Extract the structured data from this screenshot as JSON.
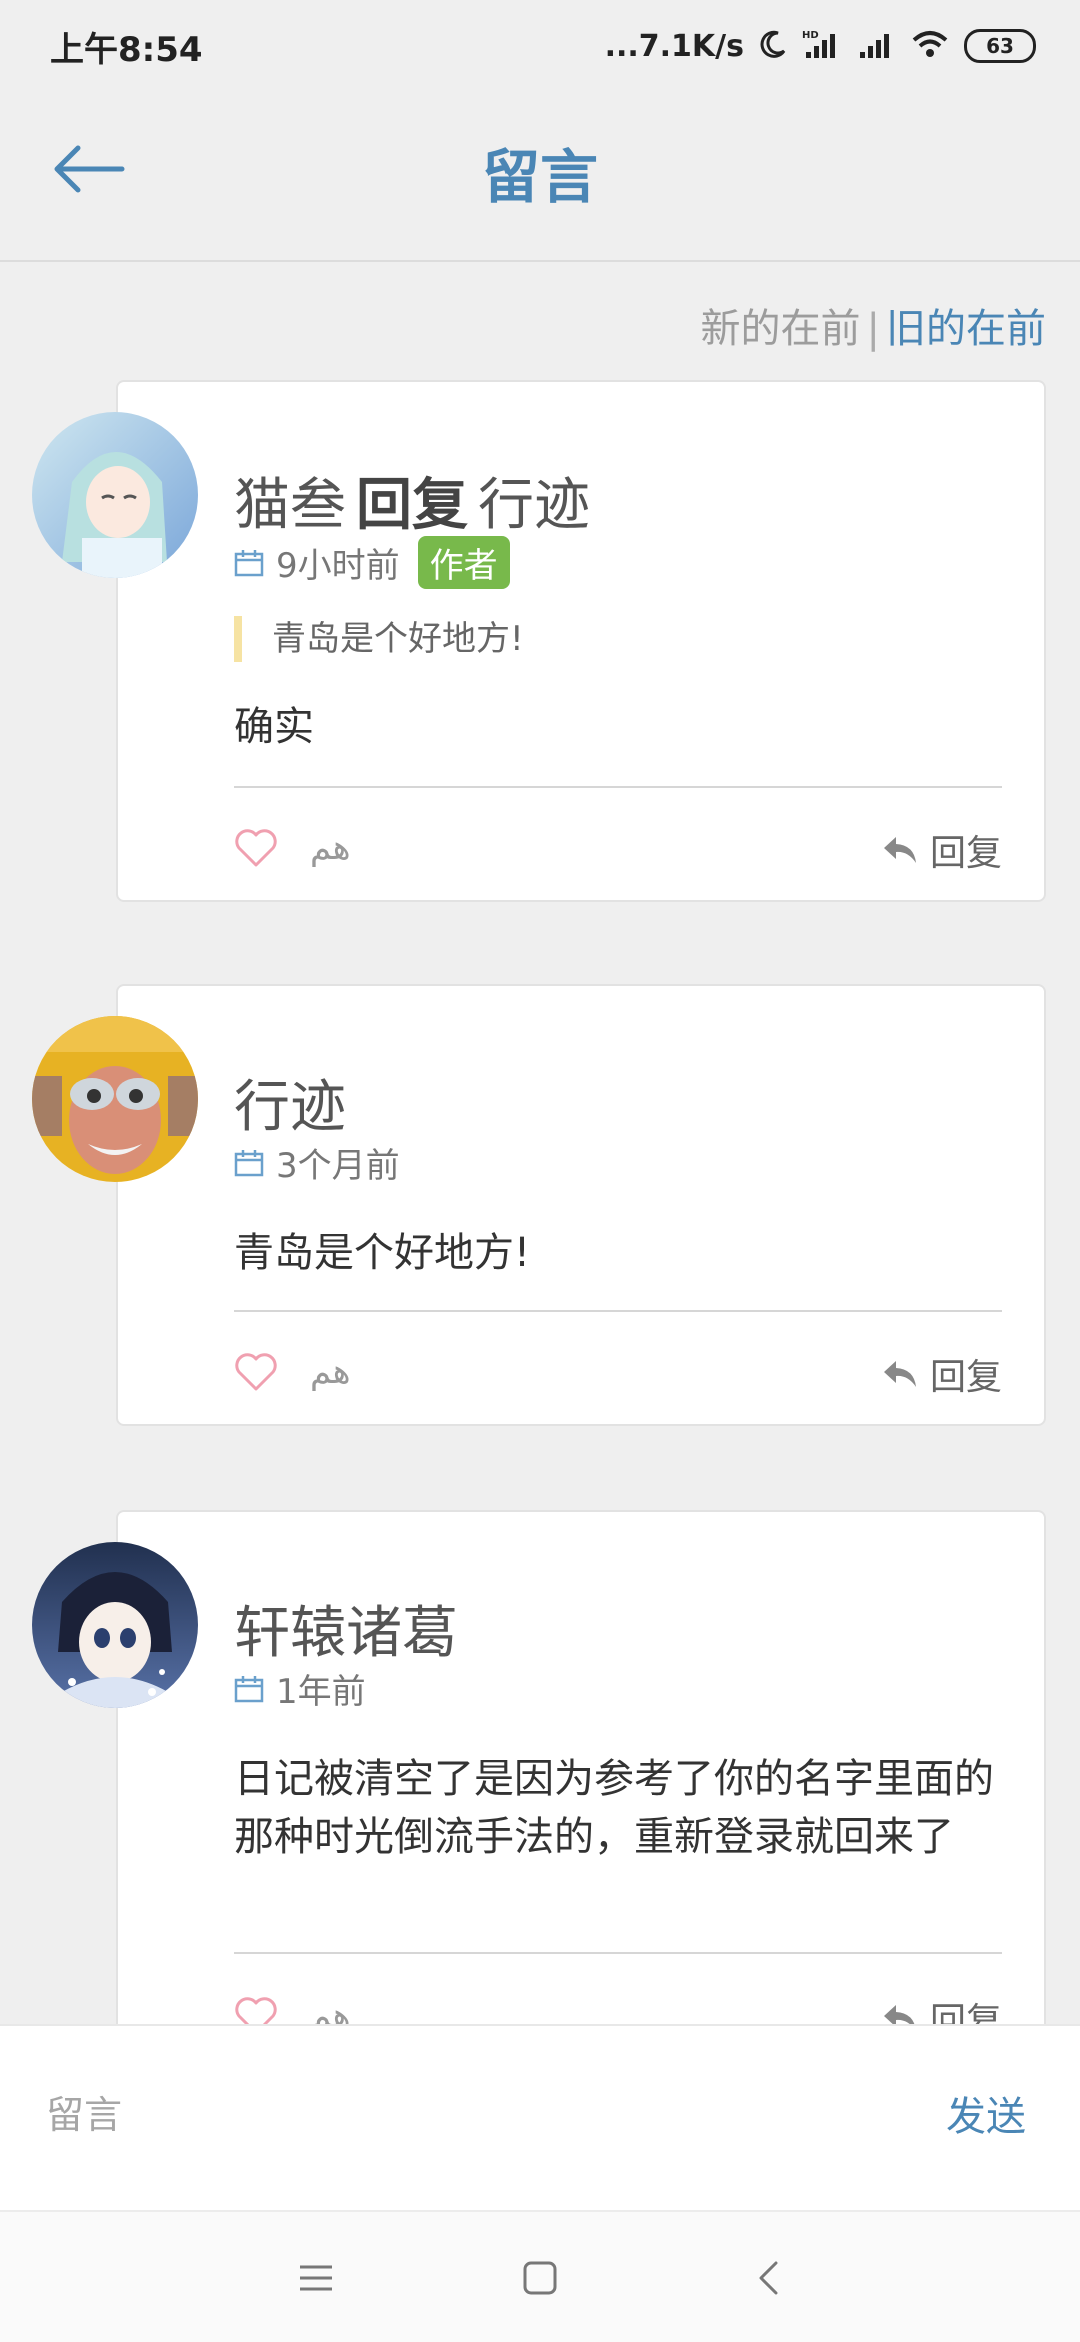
{
  "status_bar": {
    "time": "上午8:54",
    "network_speed": "...7.1K/s",
    "battery": "63"
  },
  "header": {
    "title": "留言",
    "back_icon": "arrow-left-icon"
  },
  "sort": {
    "newest_first": "新的在前",
    "separator": "|",
    "oldest_first": "旧的在前",
    "active": "oldest_first"
  },
  "comments": [
    {
      "author": "猫叁",
      "reply_word": "回复",
      "reply_to": "行迹",
      "time": "9小时前",
      "badge": "作者",
      "quote": "青岛是个好地方!",
      "text": "确实",
      "like_count": "هم",
      "reply_label": "回复"
    },
    {
      "author": "行迹",
      "time": "3个月前",
      "text": "青岛是个好地方!",
      "like_count": "هم",
      "reply_label": "回复"
    },
    {
      "author": "轩辕诸葛",
      "time": "1年前",
      "text": "日记被清空了是因为参考了你的名字里面的那种时光倒流手法的，重新登录就回来了",
      "like_count": "هم",
      "reply_label": "回复"
    }
  ],
  "input": {
    "placeholder": "留言",
    "send_label": "发送"
  },
  "colors": {
    "accent": "#4a86b5",
    "badge": "#78b94b",
    "quote_bar": "#f6e3a3",
    "like": "#f0a0b0"
  }
}
